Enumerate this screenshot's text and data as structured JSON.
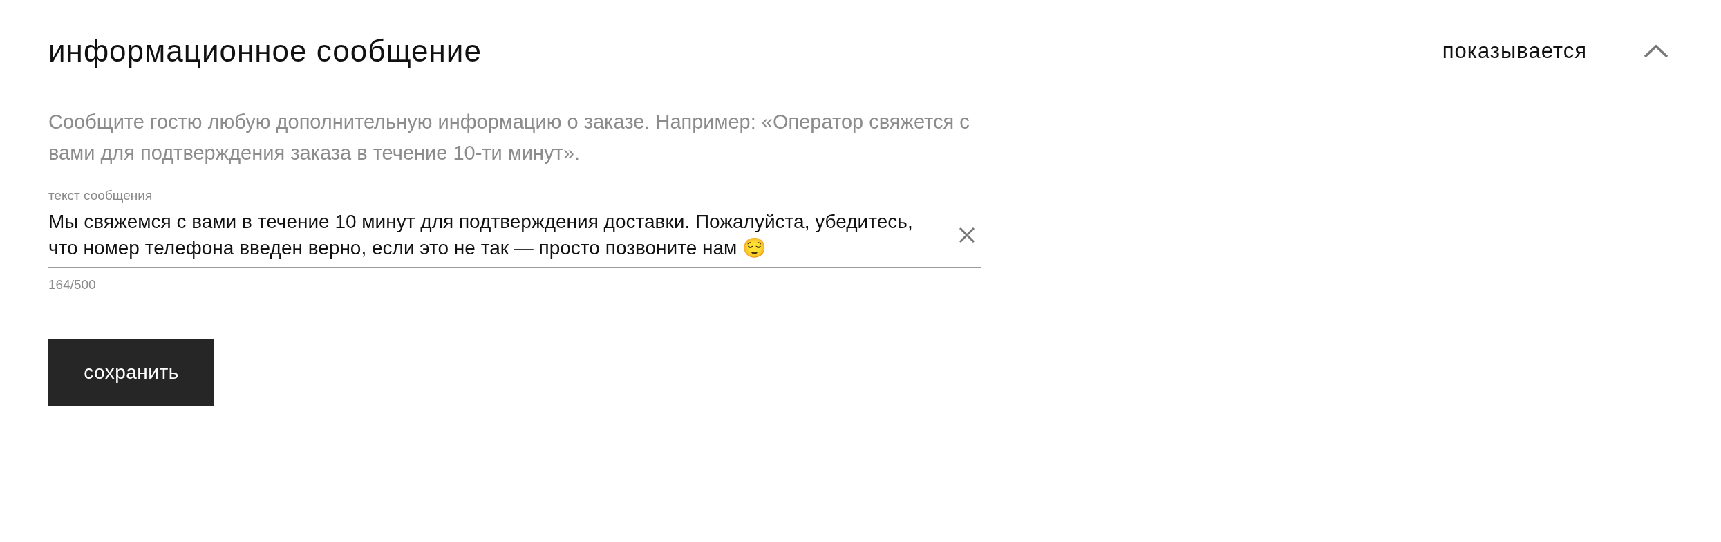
{
  "section": {
    "title": "информационное сообщение",
    "status": "показывается",
    "expanded": true
  },
  "description": "Сообщите гостю любую дополнительную информацию о заказе. Например: «Оператор свяжется с вами для подтверждения заказа в течение 10-ти минут».",
  "message_field": {
    "label": "текст сообщения",
    "value": "Мы свяжемся с вами в течение 10 минут для подтверждения доставки. Пожалуйста, убедитесь, что номер телефона введен верно, если это не так — просто позвоните нам 😌",
    "counter": "164/500"
  },
  "buttons": [
    "сохранить"
  ]
}
